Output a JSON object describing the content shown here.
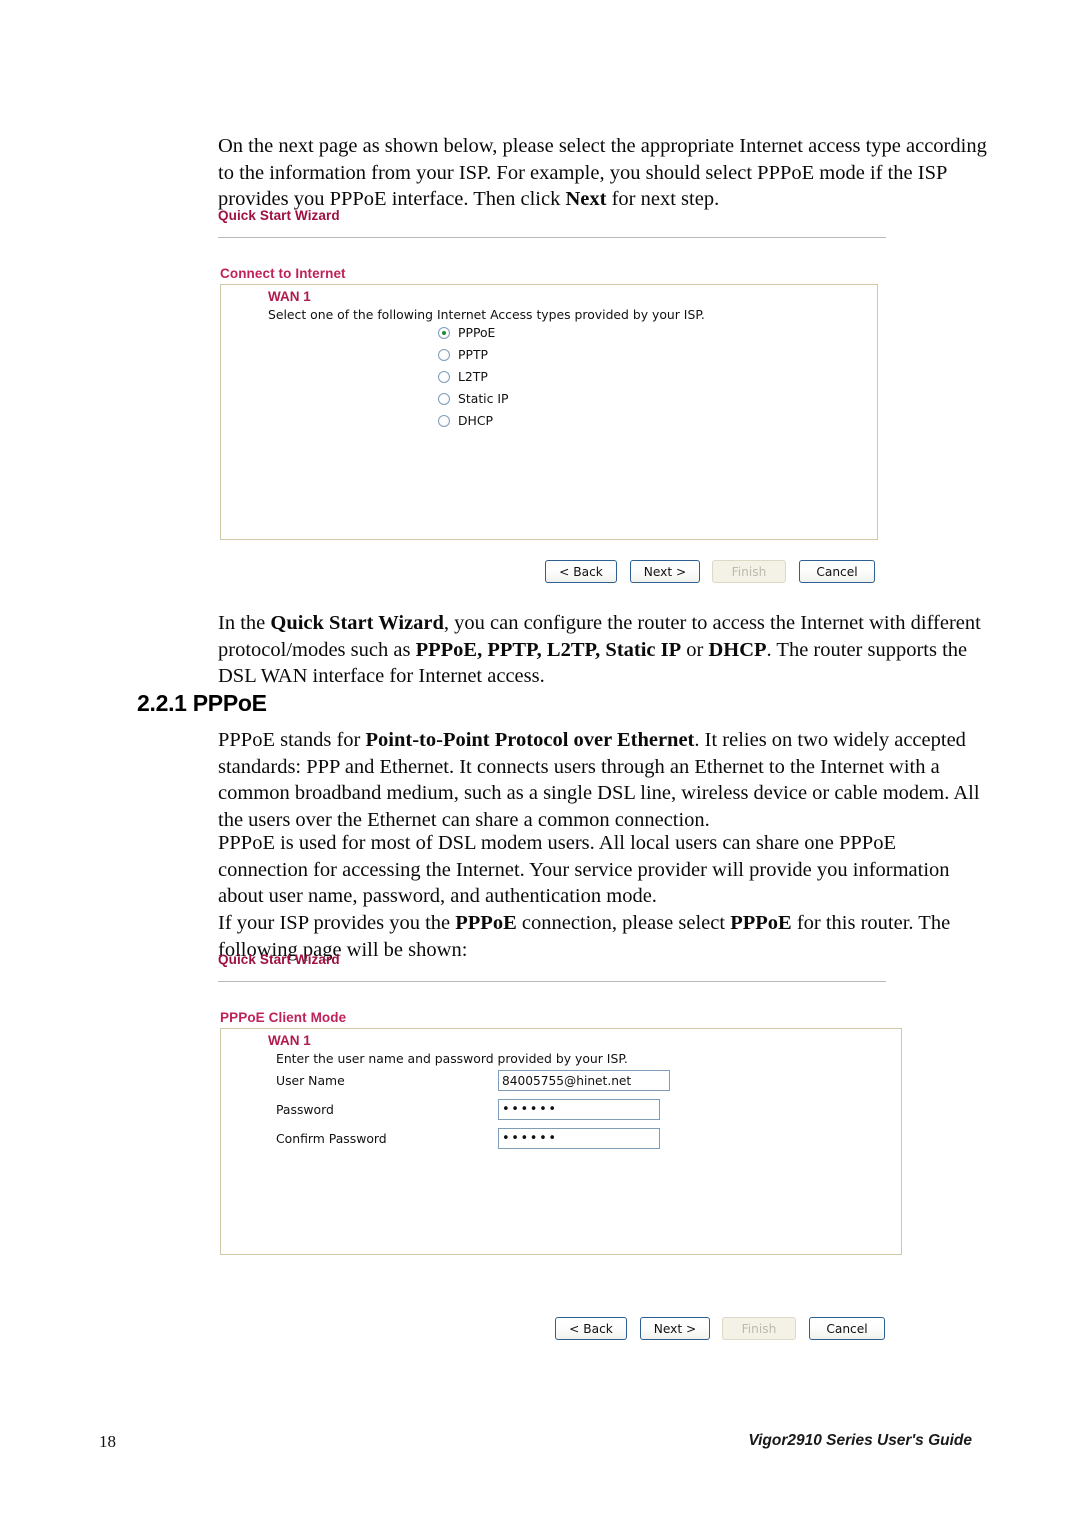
{
  "document": {
    "intro_paragraph": "On the next page as shown below, please select the appropriate Internet access type according to the information from your ISP. For example, you should select PPPoE mode if the ISP provides you PPPoE interface. Then click Next for next step.",
    "intro_bold_term": "Next",
    "wizard_paragraph_lead": "In the ",
    "wizard_paragraph_bold1": "Quick Start Wizard",
    "wizard_paragraph_mid": ", you can configure the router to access the Internet with different protocol/modes such as ",
    "wizard_modes": "PPPoE, PPTP, L2TP, Static IP",
    "wizard_or": " or ",
    "wizard_mode_last": "DHCP",
    "wizard_paragraph_tail": ". The router supports the DSL WAN interface for Internet access.",
    "section_heading": "2.2.1 PPPoE",
    "pppoe_def_lead": "PPPoE stands for ",
    "pppoe_def_bold": "Point-to-Point Protocol over Ethernet",
    "pppoe_def_tail": ". It relies on two widely accepted standards: PPP and Ethernet. It connects users through an Ethernet to the Internet with a common broadband medium, such as a single DSL line, wireless device or cable modem. All the users over the Ethernet can share a common connection.",
    "pppoe_usage_paragraph": "PPPoE is used for most of DSL modem users. All local users can share one PPPoE connection for accessing the Internet. Your service provider will provide you information about user name, password, and authentication mode.",
    "pppoe_select_lead": "If your ISP provides you the ",
    "pppoe_select_bold1": "PPPoE",
    "pppoe_select_mid": " connection, please select ",
    "pppoe_select_bold2": "PPPoE",
    "pppoe_select_tail": " for this router. The following page will be shown:"
  },
  "screenshot_connect": {
    "wizard_title": "Quick Start Wizard",
    "section_label": "Connect to Internet",
    "wan_label": "WAN 1",
    "instruction": "Select one of the following Internet Access types provided by your ISP.",
    "access_types": [
      {
        "label": "PPPoE",
        "selected": true
      },
      {
        "label": "PPTP",
        "selected": false
      },
      {
        "label": "L2TP",
        "selected": false
      },
      {
        "label": "Static IP",
        "selected": false
      },
      {
        "label": "DHCP",
        "selected": false
      }
    ],
    "buttons": [
      {
        "label": "< Back",
        "disabled": false
      },
      {
        "label": "Next >",
        "disabled": false
      },
      {
        "label": "Finish",
        "disabled": true
      },
      {
        "label": "Cancel",
        "disabled": false
      }
    ]
  },
  "screenshot_pppoe": {
    "wizard_title": "Quick Start Wizard",
    "section_label": "PPPoE Client Mode",
    "wan_label": "WAN 1",
    "instruction": "Enter the user name and password provided by your ISP.",
    "fields": [
      {
        "label": "User Name",
        "value": "84005755@hinet.net",
        "masked": false
      },
      {
        "label": "Password",
        "value": "••••••",
        "masked": true
      },
      {
        "label": "Confirm Password",
        "value": "••••••",
        "masked": true
      }
    ],
    "buttons": [
      {
        "label": "< Back",
        "disabled": false
      },
      {
        "label": "Next >",
        "disabled": false
      },
      {
        "label": "Finish",
        "disabled": true
      },
      {
        "label": "Cancel",
        "disabled": false
      }
    ]
  },
  "footer": {
    "page_number": "18",
    "guide_title": "Vigor2910 Series User's Guide"
  },
  "colors": {
    "heading_red": "#9e1040",
    "section_pink": "#c0215a",
    "wan_red": "#b01a4e",
    "panel_border": "#cdc9a5",
    "input_border": "#7f9db9",
    "button_border": "#2d5f93",
    "radio_selected_dot": "#1d8f2a"
  }
}
